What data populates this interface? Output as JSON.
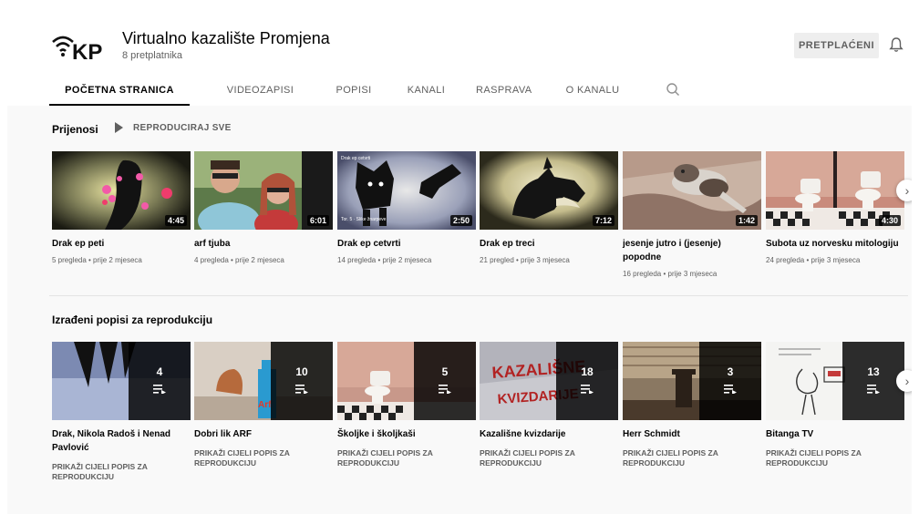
{
  "channel": {
    "logo_text": "KP",
    "title": "Virtualno kazalište Promjena",
    "subscribers": "8 pretplatnika",
    "subscribe_label": "PRETPLAĆENI"
  },
  "tabs": [
    {
      "label": "POČETNA STRANICA",
      "active": true
    },
    {
      "label": "VIDEOZAPISI"
    },
    {
      "label": "POPISI"
    },
    {
      "label": "KANALI"
    },
    {
      "label": "RASPRAVA"
    },
    {
      "label": "O KANALU"
    }
  ],
  "uploads": {
    "title": "Prijenosi",
    "play_all": "REPRODUCIRAJ SVE",
    "videos": [
      {
        "title": "Drak ep peti",
        "meta": "5 pregleda • prije 2 mjeseca",
        "duration": "4:45"
      },
      {
        "title": "arf tjuba",
        "meta": "4 pregleda • prije 2 mjeseca",
        "duration": "6:01"
      },
      {
        "title": "Drak ep cetvrti",
        "meta": "14 pregleda • prije 2 mjeseca",
        "duration": "2:50",
        "overlay_top": "Drak ep cetvrti",
        "overlay_bottom": "Tor. 5 · Slike žnarpeve"
      },
      {
        "title": "Drak ep treci",
        "meta": "21 pregled • prije 3 mjeseca",
        "duration": "7:12"
      },
      {
        "title": "jesenje jutro i (jesenje) popodne",
        "meta": "16 pregleda • prije 3 mjeseca",
        "duration": "1:42"
      },
      {
        "title": "Subota uz norvesku mitologiju",
        "meta": "24 pregleda • prije 3 mjeseca",
        "duration": "4:30"
      }
    ]
  },
  "playlists": {
    "title": "Izrađeni popisi za reprodukciju",
    "items": [
      {
        "title": "Drak, Nikola Radoš i Nenad Pavlović",
        "count": "4",
        "link": "PRIKAŽI CIJELI POPIS ZA REPRODUKCIJU"
      },
      {
        "title": "Dobri lik ARF",
        "count": "10",
        "link": "PRIKAŽI CIJELI POPIS ZA REPRODUKCIJU",
        "thumb_text": "Arf"
      },
      {
        "title": "Školjke i školjkaši",
        "count": "5",
        "link": "PRIKAŽI CIJELI POPIS ZA REPRODUKCIJU"
      },
      {
        "title": "Kazališne kvizdarije",
        "count": "18",
        "link": "PRIKAŽI CIJELI POPIS ZA REPRODUKCIJU",
        "thumb_line1": "KAZALIŠNE",
        "thumb_line2": "KVIZDARIJE"
      },
      {
        "title": "Herr Schmidt",
        "count": "3",
        "link": "PRIKAŽI CIJELI POPIS ZA REPRODUKCIJU"
      },
      {
        "title": "Bitanga TV",
        "count": "13",
        "link": "PRIKAŽI CIJELI POPIS ZA REPRODUKCIJU"
      }
    ]
  },
  "icons": {
    "next": "chevron-right-icon",
    "bell": "bell-icon",
    "search": "search-icon",
    "playlist": "playlist-icon",
    "play": "play-icon",
    "wifi": "wifi-icon"
  }
}
